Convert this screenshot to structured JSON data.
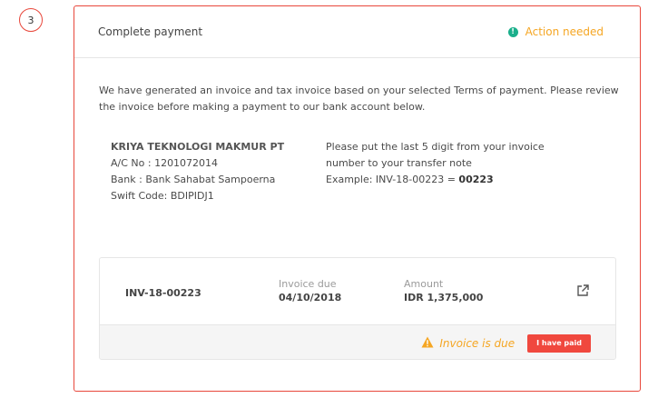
{
  "step": {
    "number": "3"
  },
  "header": {
    "title": "Complete payment",
    "status": "Action needed",
    "status_color": "#f5a623",
    "status_icon": "info-icon"
  },
  "intro": "We have generated an invoice and tax invoice based on your selected Terms of payment. Please review the invoice before making a payment to our bank account below.",
  "bank": {
    "name": "KRIYA TEKNOLOGI MAKMUR PT",
    "account": "A/C No : 1201072014",
    "bank": "Bank : Bank Sahabat Sampoerna",
    "swift": "Swift Code: BDIPIDJ1"
  },
  "note": {
    "line1": "Please put the last 5 digit from your invoice",
    "line2": "number to your transfer note",
    "example_prefix": "Example: INV-18-00223 = ",
    "example_code": "00223"
  },
  "invoice": {
    "number": "INV-18-00223",
    "due_label": "Invoice due",
    "due_value": "04/10/2018",
    "amount_label": "Amount",
    "amount_value": "IDR 1,375,000",
    "open_icon": "external-link-icon",
    "due_status": "Invoice is due",
    "due_status_icon": "warning-icon",
    "paid_button": "I have paid"
  },
  "colors": {
    "accent_red": "#f0483e",
    "warning_orange": "#f5a623",
    "success_green": "#1aaf8b"
  }
}
